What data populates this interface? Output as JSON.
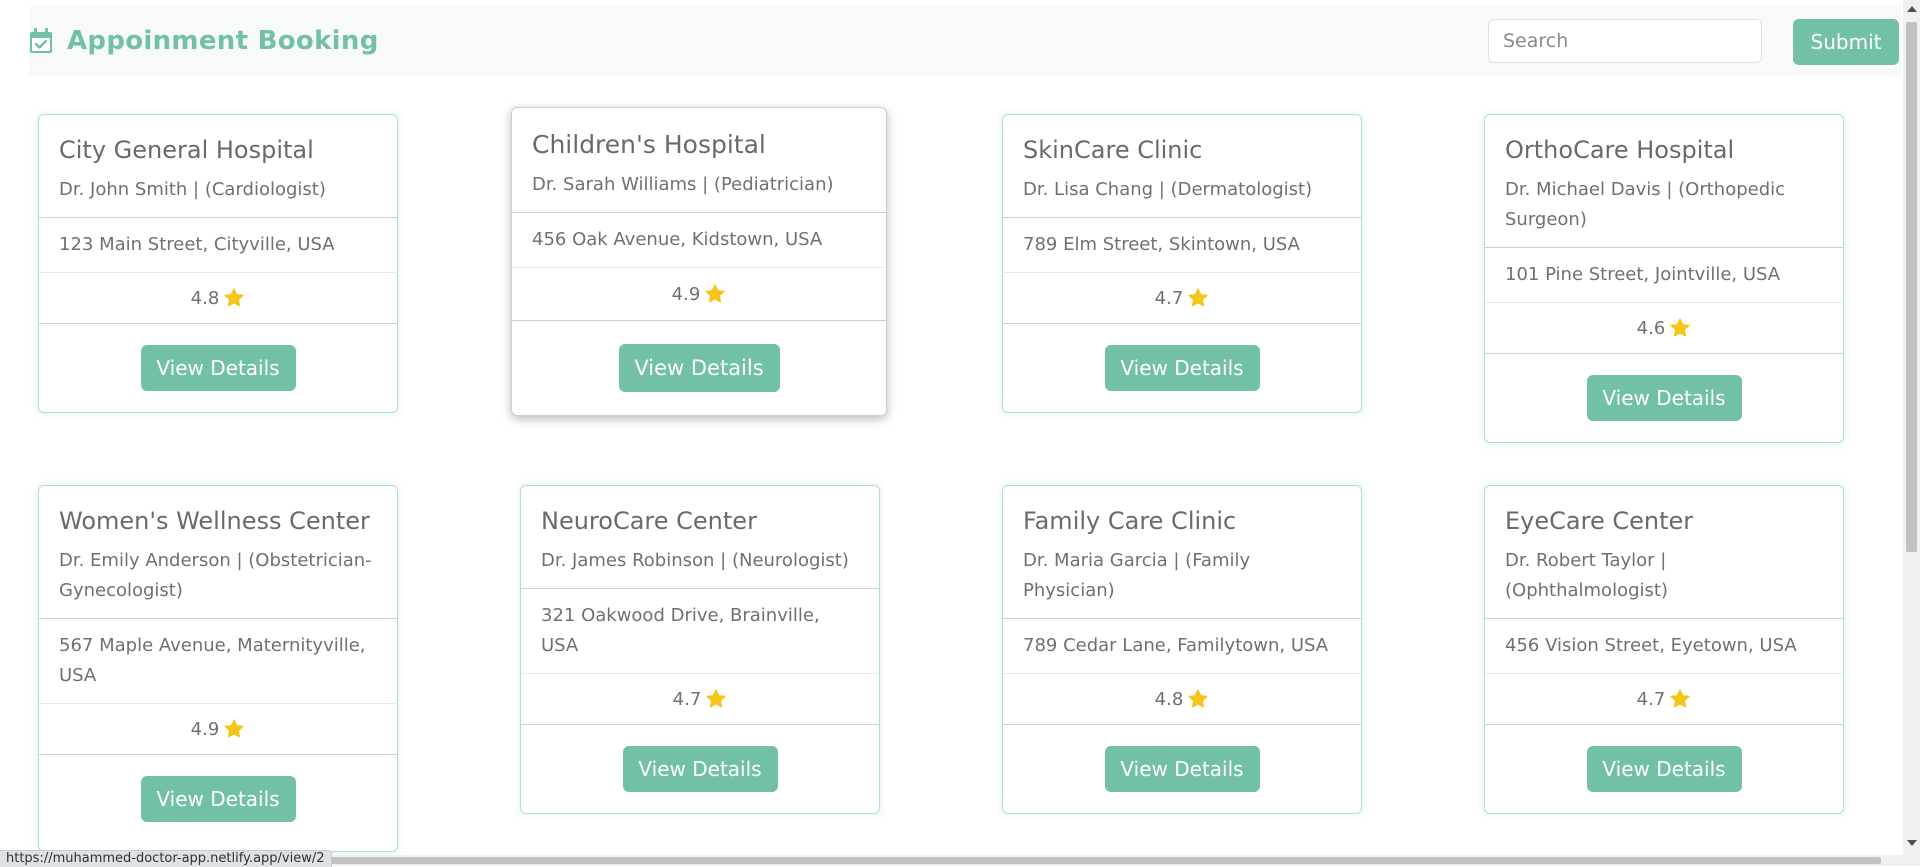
{
  "navbar": {
    "brand_icon": "calendar-check-icon",
    "brand": "Appoinment Booking",
    "search_placeholder": "Search",
    "submit_label": "Submit"
  },
  "colors": {
    "accent": "#72c1a6",
    "star": "#f5c518",
    "card_border": "#aee3c8"
  },
  "cards": [
    {
      "title": "City General Hospital",
      "doctor": "Dr. John Smith | (Cardiologist)",
      "address": "123 Main Street, Cityville, USA",
      "rating": "4.8",
      "button": "View Details"
    },
    {
      "title": "Children's Hospital",
      "doctor": "Dr. Sarah Williams | (Pediatrician)",
      "address": "456 Oak Avenue, Kidstown, USA",
      "rating": "4.9",
      "button": "View Details"
    },
    {
      "title": "SkinCare Clinic",
      "doctor": "Dr. Lisa Chang | (Dermatologist)",
      "address": "789 Elm Street, Skintown, USA",
      "rating": "4.7",
      "button": "View Details"
    },
    {
      "title": "OrthoCare Hospital",
      "doctor": "Dr. Michael Davis | (Orthopedic Surgeon)",
      "address": "101 Pine Street, Jointville, USA",
      "rating": "4.6",
      "button": "View Details"
    },
    {
      "title": "Women's Wellness Center",
      "doctor": "Dr. Emily Anderson | (Obstetrician-Gynecologist)",
      "address": "567 Maple Avenue, Maternityville, USA",
      "rating": "4.9",
      "button": "View Details"
    },
    {
      "title": "NeuroCare Center",
      "doctor": "Dr. James Robinson | (Neurologist)",
      "address": "321 Oakwood Drive, Brainville, USA",
      "rating": "4.7",
      "button": "View Details"
    },
    {
      "title": "Family Care Clinic",
      "doctor": "Dr. Maria Garcia | (Family Physician)",
      "address": "789 Cedar Lane, Familytown, USA",
      "rating": "4.8",
      "button": "View Details"
    },
    {
      "title": "EyeCare Center",
      "doctor": "Dr. Robert Taylor | (Ophthalmologist)",
      "address": "456 Vision Street, Eyetown, USA",
      "rating": "4.7",
      "button": "View Details"
    }
  ],
  "status_url": "https://muhammed-doctor-app.netlify.app/view/2"
}
